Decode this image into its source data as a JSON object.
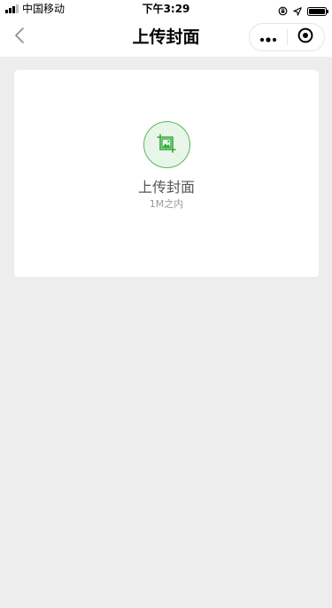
{
  "status_bar": {
    "carrier": "中国移动",
    "time": "下午3:29",
    "icons": [
      "signal-icon",
      "lock-rotation-icon",
      "location-arrow-icon",
      "battery-icon"
    ]
  },
  "nav": {
    "title": "上传封面",
    "back_icon": "chevron-left-icon",
    "more_icon": "more-dots-icon",
    "close_icon": "target-close-icon"
  },
  "upload": {
    "label": "上传封面",
    "hint": "1M之内",
    "icon": "image-crop-icon"
  },
  "colors": {
    "background": "#ededed",
    "card": "#ffffff",
    "accent_green": "#2faa3a",
    "accent_green_light": "#e8f6e9",
    "label_gray": "#555555",
    "hint_gray": "#9a9a9a"
  }
}
